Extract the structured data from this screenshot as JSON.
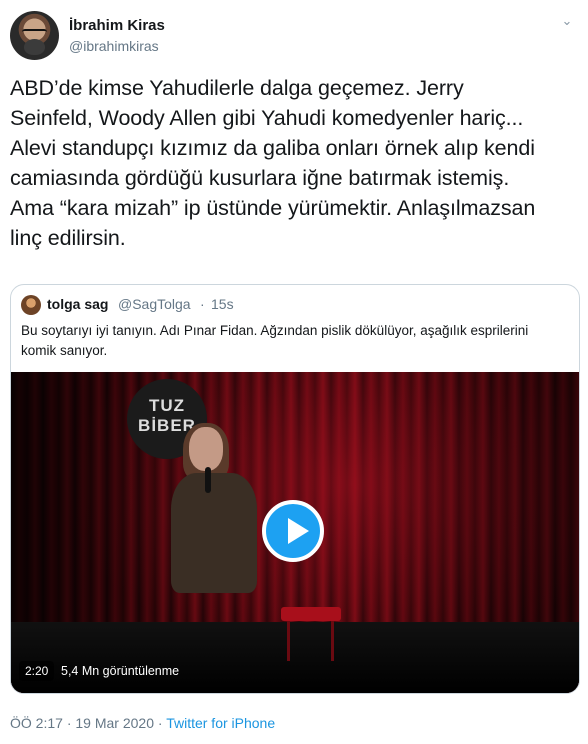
{
  "author": {
    "name": "İbrahim Kiras",
    "handle": "@ibrahimkiras"
  },
  "tweet": {
    "lines": [
      "ABD’de kimse Yahudilerle dalga geçemez. Jerry",
      "Seinfeld, Woody Allen gibi Yahudi komedyenler hariç...",
      "Alevi standupçı kızımız da galiba onları örnek alıp kendi",
      "camiasında gördüğü kusurlara iğne batırmak istemiş.",
      "Ama “kara mizah” ip üstünde yürümektir. Anlaşılmazsan",
      "linç edilirsin."
    ]
  },
  "quoted": {
    "name": "tolga sag",
    "handle": "@SagTolga",
    "separator": "·",
    "time": "15s",
    "text": "Bu soytarıyı iyi tanıyın. Adı Pınar Fidan. Ağzından pislik dökülüyor, aşağılık esprilerini komik sanıyor.",
    "video": {
      "logo_text": "TUZ BİBER",
      "duration": "2:20",
      "views": "5,4 Mn görüntülenme"
    }
  },
  "footer": {
    "time": "ÖÖ 2:17",
    "separator": "·",
    "date": "19 Mar 2020",
    "separator2": "·",
    "source": "Twitter for iPhone"
  },
  "icons": {
    "more": "chevron-down-icon",
    "play": "play-icon"
  },
  "colors": {
    "accent": "#1da1f2",
    "link": "#1b95e0",
    "secondary_text": "#657786",
    "border": "#ccd6dd"
  }
}
